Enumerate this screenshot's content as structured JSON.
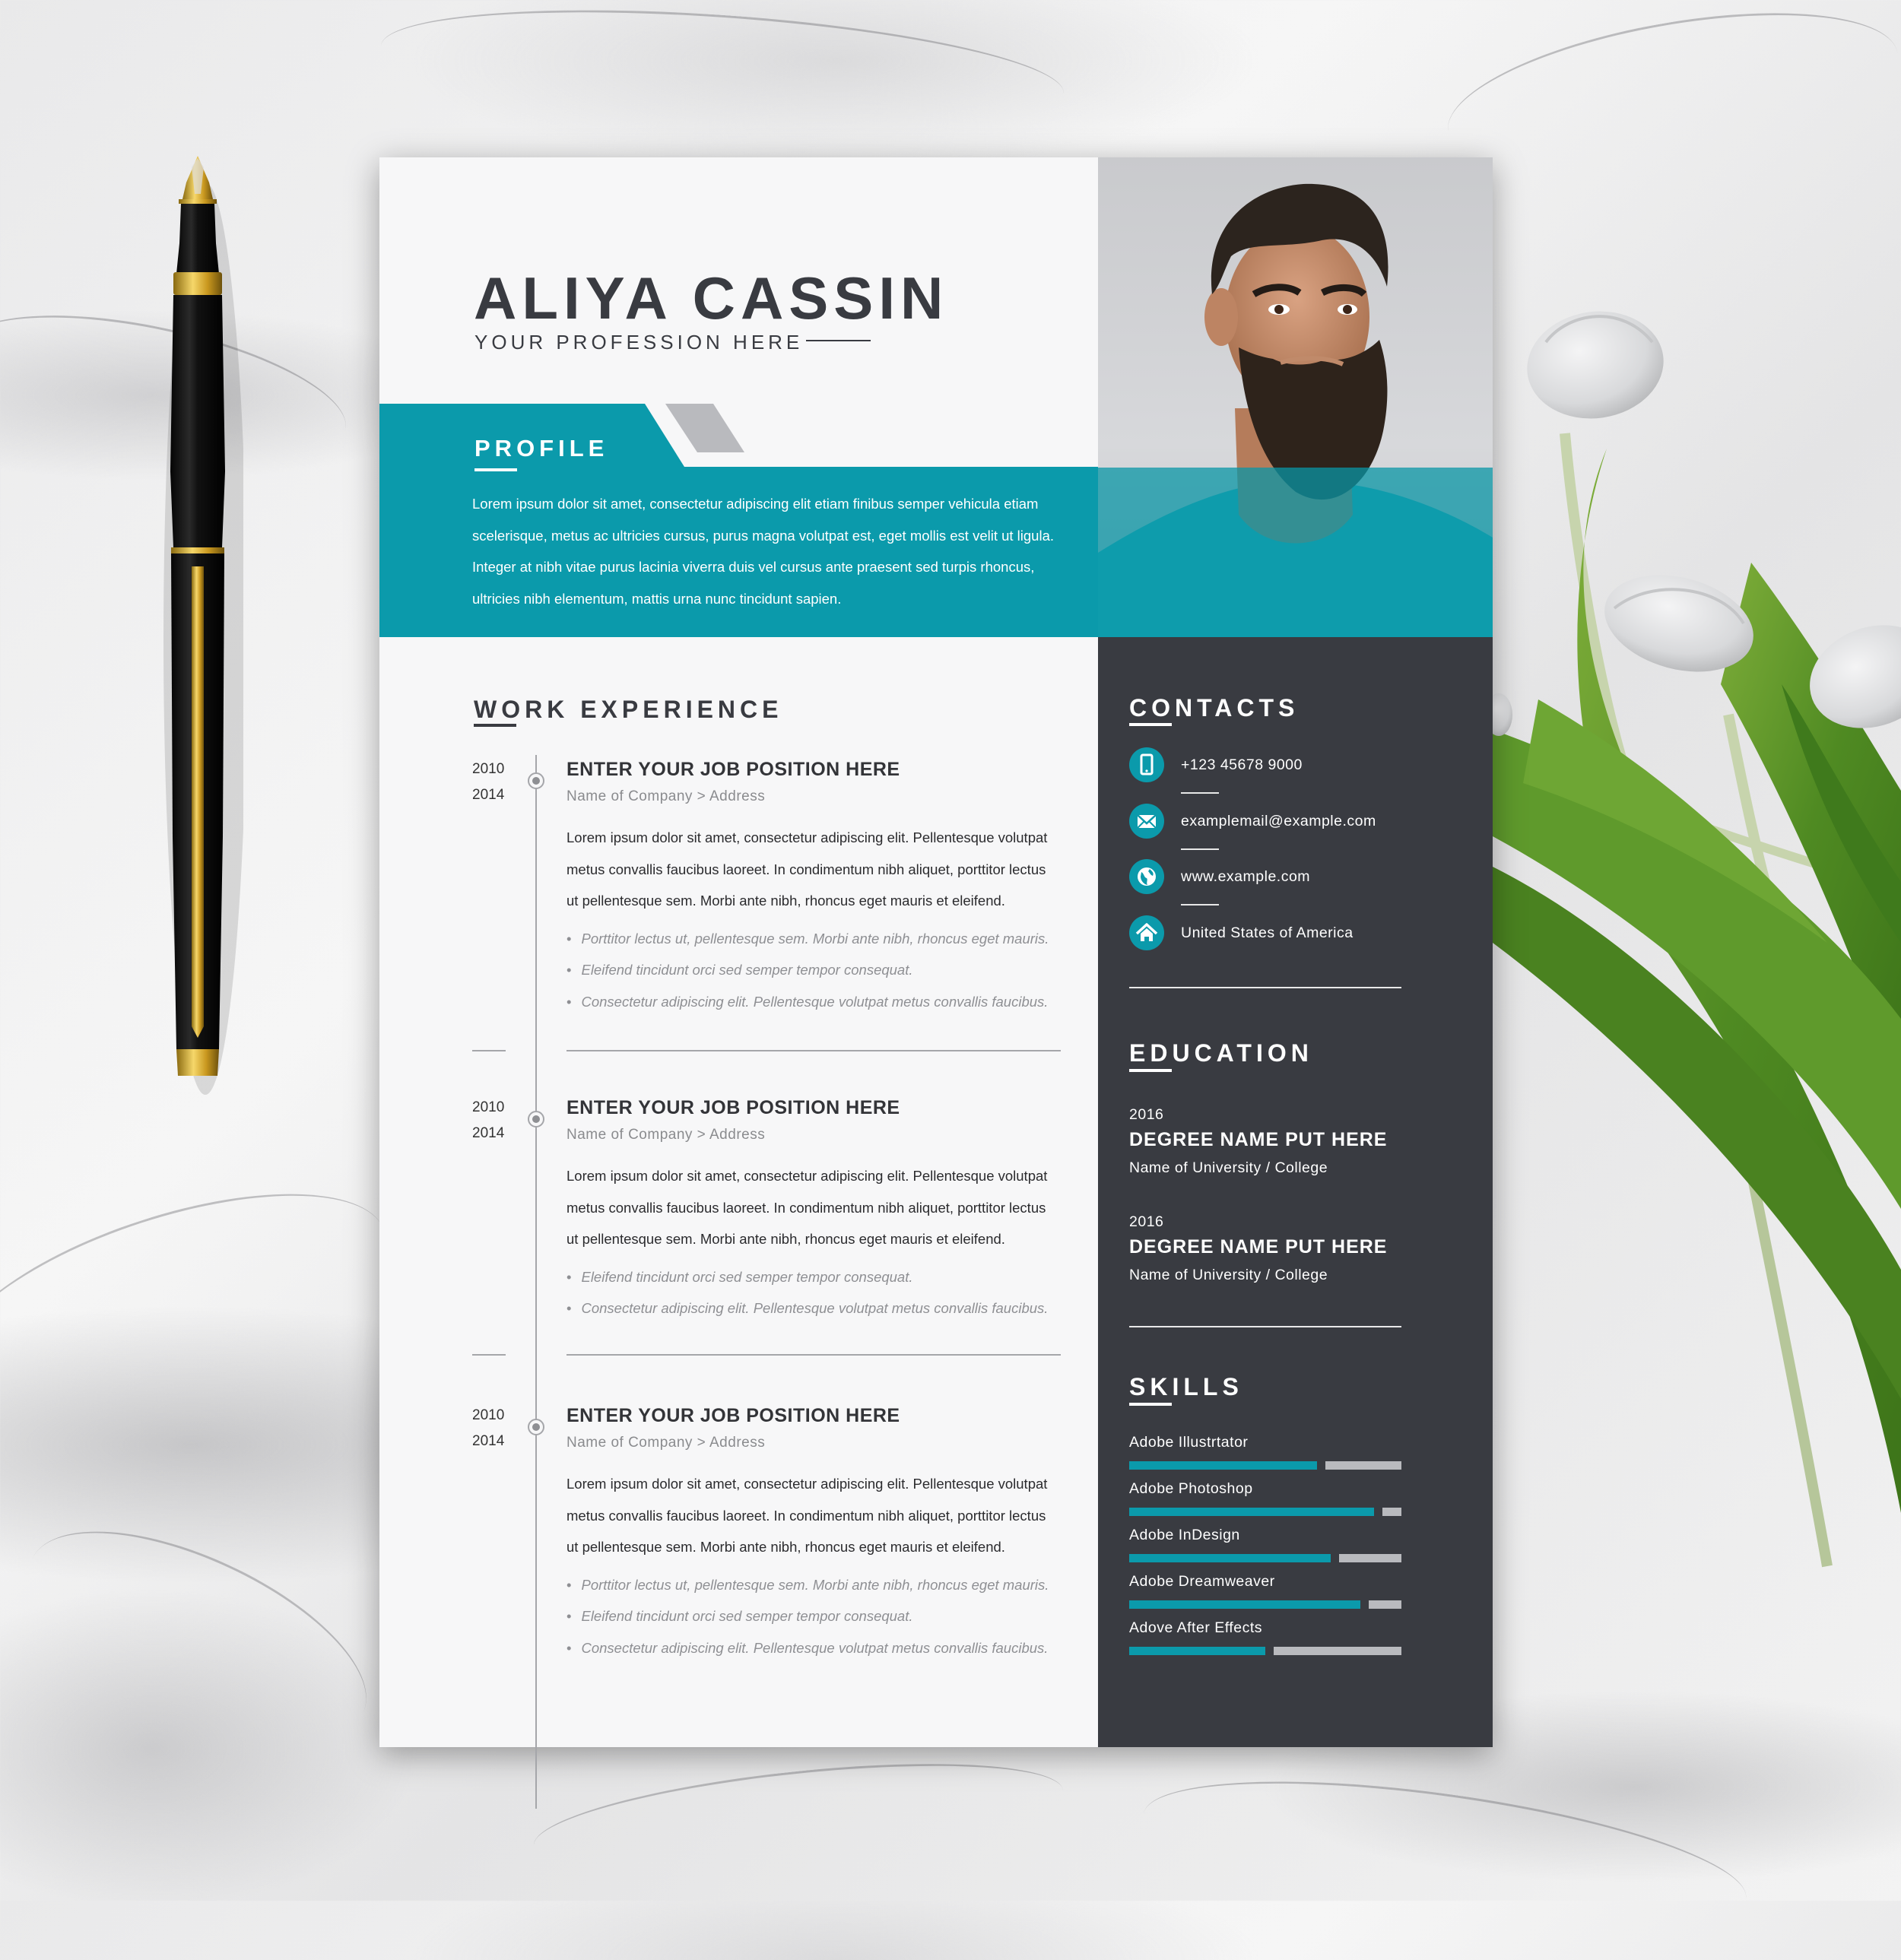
{
  "resume": {
    "name": "ALIYA CASSIN",
    "profession": "YOUR PROFESSION HERE",
    "profile": {
      "heading": "PROFILE",
      "lines": [
        "Lorem ipsum dolor sit amet, consectetur adipiscing elit etiam finibus semper vehicula etiam",
        "scelerisque, metus ac ultricies cursus, purus magna volutpat est, eget mollis est velit ut ligula.",
        "Integer at nibh vitae purus lacinia viverra duis vel cursus ante praesent sed turpis rhoncus,",
        "ultricies nibh elementum, mattis urna nunc tincidunt sapien."
      ]
    },
    "work": {
      "heading": "WORK EXPERIENCE",
      "jobs": [
        {
          "start": "2010",
          "end": "2014",
          "title": "ENTER YOUR JOB POSITION HERE",
          "company": "Name of Company > Address",
          "lines": [
            "Lorem ipsum dolor sit amet, consectetur adipiscing elit. Pellentesque volutpat",
            "metus convallis faucibus laoreet. In condimentum nibh aliquet, porttitor lectus",
            "ut  pellentesque sem. Morbi ante nibh, rhoncus eget mauris et eleifend."
          ],
          "bullets": [
            "Porttitor lectus ut, pellentesque sem. Morbi ante nibh, rhoncus eget mauris.",
            "Eleifend tincidunt orci sed semper tempor consequat.",
            "Consectetur adipiscing elit. Pellentesque volutpat metus convallis faucibus."
          ]
        },
        {
          "start": "2010",
          "end": "2014",
          "title": "ENTER YOUR JOB POSITION HERE",
          "company": "Name of Company > Address",
          "lines": [
            "Lorem ipsum dolor sit amet, consectetur adipiscing elit. Pellentesque volutpat",
            "metus convallis faucibus laoreet. In condimentum nibh aliquet, porttitor lectus",
            "ut  pellentesque sem. Morbi ante nibh, rhoncus eget mauris et eleifend."
          ],
          "bullets": [
            "Eleifend tincidunt orci sed semper tempor consequat.",
            "Consectetur adipiscing elit. Pellentesque volutpat metus convallis faucibus."
          ]
        },
        {
          "start": "2010",
          "end": "2014",
          "title": "ENTER YOUR JOB POSITION HERE",
          "company": "Name of Company > Address",
          "lines": [
            "Lorem ipsum dolor sit amet, consectetur adipiscing elit. Pellentesque volutpat",
            "metus convallis faucibus laoreet. In condimentum nibh aliquet, porttitor lectus",
            "ut  pellentesque sem. Morbi ante nibh, rhoncus eget mauris et eleifend."
          ],
          "bullets": [
            "Porttitor lectus ut, pellentesque sem. Morbi ante nibh, rhoncus eget mauris.",
            "Eleifend tincidunt orci sed semper tempor consequat.",
            "Consectetur adipiscing elit. Pellentesque volutpat metus convallis faucibus."
          ]
        }
      ]
    },
    "contacts": {
      "heading": "CONTACTS",
      "items": [
        {
          "icon": "phone-icon",
          "text": "+123 45678 9000"
        },
        {
          "icon": "mail-icon",
          "text": "examplemail@example.com"
        },
        {
          "icon": "globe-icon",
          "text": "www.example.com"
        },
        {
          "icon": "home-icon",
          "text": "United States of America"
        }
      ]
    },
    "education": {
      "heading": "EDUCATION",
      "items": [
        {
          "year": "2016",
          "degree": "DEGREE NAME PUT HERE",
          "school": "Name of University / College"
        },
        {
          "year": "2016",
          "degree": "DEGREE NAME PUT HERE",
          "school": "Name of University / College"
        }
      ]
    },
    "skills": {
      "heading": "SKILLS",
      "items": [
        {
          "name": "Adobe Illustrtator",
          "level": 0.69
        },
        {
          "name": "Adobe Photoshop",
          "level": 0.9
        },
        {
          "name": "Adobe InDesign",
          "level": 0.74
        },
        {
          "name": "Adobe Dreamweaver",
          "level": 0.85
        },
        {
          "name": "Adove After Effects",
          "level": 0.5
        }
      ]
    }
  },
  "colors": {
    "accent": "#0b9aab",
    "sidebar": "#393b41",
    "text_dark": "#393b41",
    "bar_track": "#b9babe",
    "page": "#f7f7f8"
  }
}
